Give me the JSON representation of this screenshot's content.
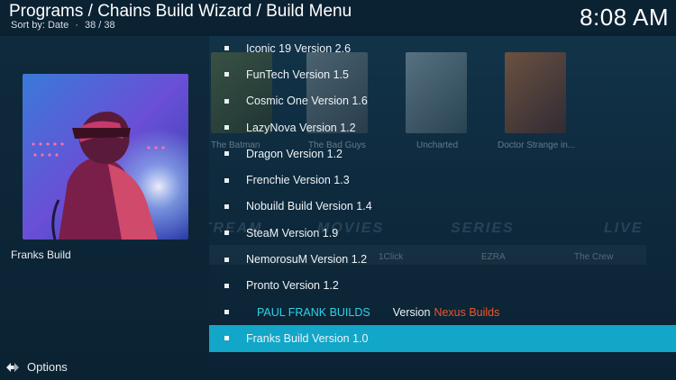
{
  "header": {
    "breadcrumb": "Programs / Chains Build Wizard / Build Menu",
    "sort_label": "Sort by: Date",
    "separator": "·",
    "count": "38 / 38",
    "clock": "8:08 AM"
  },
  "left_panel": {
    "selected_title": "Franks Build",
    "options_label": "Options"
  },
  "background": {
    "posters": [
      "The Batman",
      "The Bad Guys",
      "Uncharted",
      "Doctor Strange in..."
    ],
    "nav_words": [
      "STREAM",
      "MOVIES",
      "SERIES",
      "LIVE"
    ],
    "sub_words": [
      "1Click",
      "EZRA",
      "The Crew"
    ]
  },
  "list": {
    "items": [
      {
        "label": "Iconic 19 Version 2.6"
      },
      {
        "label": "FunTech Version 1.5"
      },
      {
        "label": "Cosmic One Version 1.6"
      },
      {
        "label": "LazyNova Version 1.2"
      },
      {
        "label": "Dragon Version 1.2"
      },
      {
        "label": "Frenchie Version 1.3"
      },
      {
        "label": "Nobuild Build Version 1.4"
      },
      {
        "label": "SteaM Version 1.9"
      },
      {
        "label": "NemorosuM Version 1.2"
      },
      {
        "label": "Pronto Version 1.2"
      }
    ],
    "header_item": {
      "cyan_text": "PAUL FRANK BUILDS",
      "mid_text": "Version",
      "orange_text": "Nexus Builds"
    },
    "selected_item": {
      "label": "Franks Build Version 1.0"
    }
  },
  "colors": {
    "selection": "#12a6c8",
    "cyan_text": "#2fd2e6",
    "orange_text": "#f0552a"
  }
}
